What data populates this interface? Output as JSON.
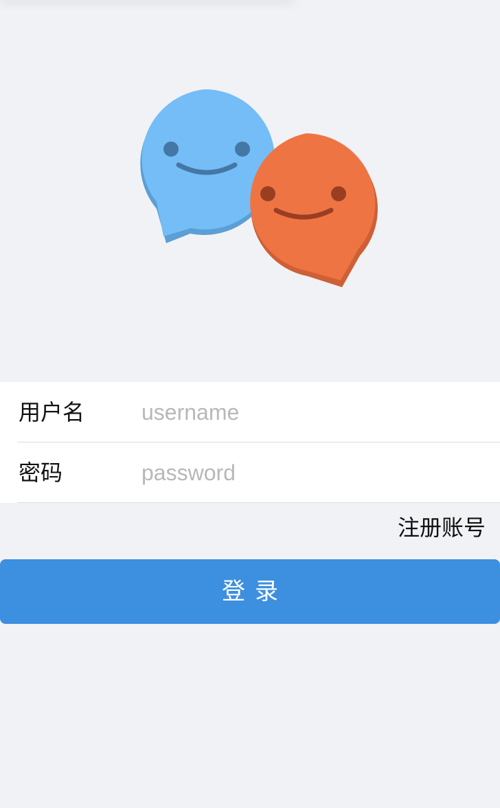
{
  "logo": {
    "icon": "chat-bubbles-smiley-icon",
    "colors": {
      "blue_bubble": "#74bdf7",
      "blue_shade": "#5b9fd6",
      "blue_features": "#4477a6",
      "orange_bubble": "#ee7543",
      "orange_shade": "#cf5f35",
      "orange_features": "#9a3e22"
    }
  },
  "form": {
    "username": {
      "label": "用户名",
      "value": "",
      "placeholder": "username"
    },
    "password": {
      "label": "密码",
      "value": "",
      "placeholder": "password"
    }
  },
  "register_link": "注册账号",
  "login_button": "登录",
  "colors": {
    "background": "#f1f2f5",
    "form_background": "#ffffff",
    "primary": "#3d8fe0",
    "placeholder": "#b8b8b8"
  }
}
